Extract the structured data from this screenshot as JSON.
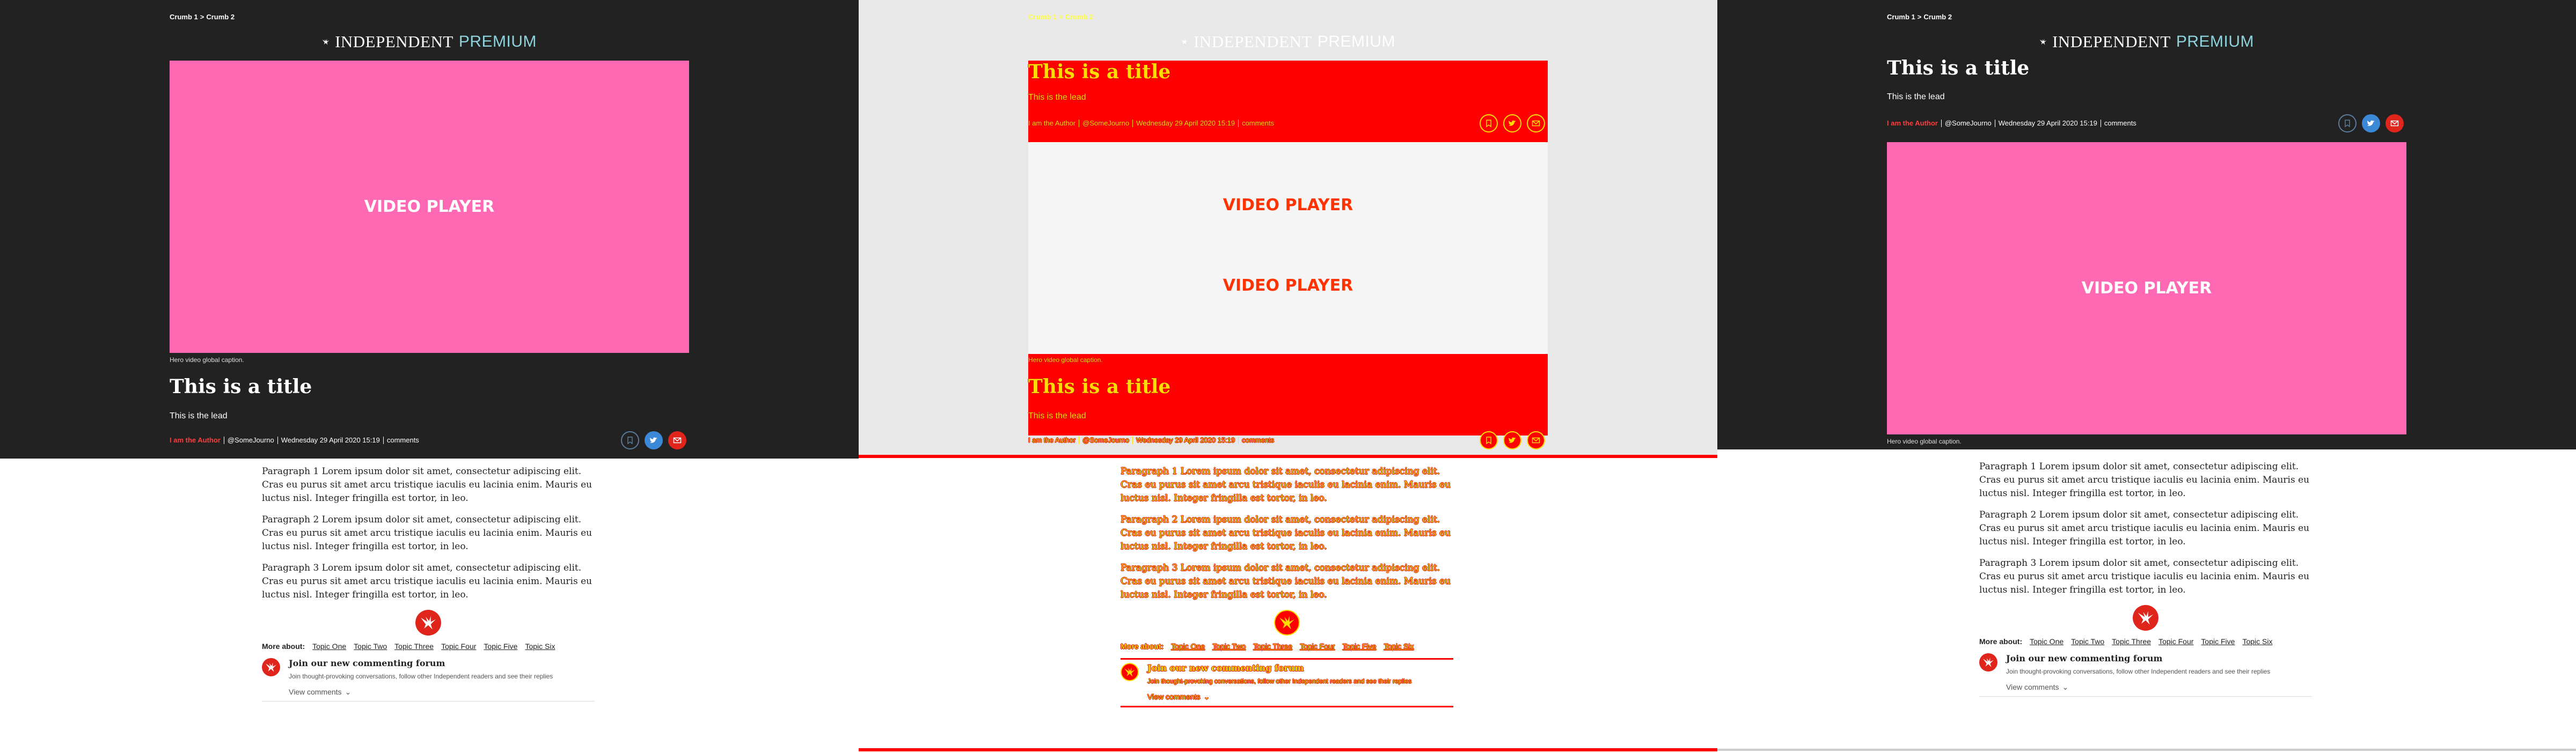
{
  "breadcrumbs": [
    "Crumb 1",
    "Crumb 2"
  ],
  "breadcrumb_separator": ">",
  "logo": {
    "brand": "INDEPENDENT",
    "premium": "PREMIUM"
  },
  "video": {
    "label": "VIDEO PLAYER",
    "caption": "Hero video global caption."
  },
  "article": {
    "title": "This is a title",
    "lead": "This is the lead",
    "author": "I am the Author",
    "handle": "@SomeJourno",
    "date": "Wednesday 29 April 2020 15:19",
    "comments_link": "comments"
  },
  "share": {
    "bookmark": "bookmark-icon",
    "twitter": "twitter-icon",
    "email": "email-icon"
  },
  "paragraphs": [
    "Paragraph 1 Lorem ipsum dolor sit amet, consectetur adipiscing elit. Cras eu purus sit amet arcu tristique iaculis eu lacinia enim. Mauris eu luctus nisl. Integer fringilla est tortor, in leo.",
    "Paragraph 2 Lorem ipsum dolor sit amet, consectetur adipiscing elit. Cras eu purus sit amet arcu tristique iaculis eu lacinia enim. Mauris eu luctus nisl. Integer fringilla est tortor, in leo.",
    "Paragraph 3 Lorem ipsum dolor sit amet, consectetur adipiscing elit. Cras eu purus sit amet arcu tristique iaculis eu lacinia enim. Mauris eu luctus nisl. Integer fringilla est tortor, in leo."
  ],
  "more_about": {
    "label": "More about:",
    "topics": [
      "Topic One",
      "Topic Two",
      "Topic Three",
      "Topic Four",
      "Topic Five",
      "Topic Six"
    ]
  },
  "comments_forum": {
    "title": "Join our new commenting forum",
    "subtitle": "Join thought-provoking conversations, follow other Independent readers and see their replies",
    "view_label": "View comments"
  },
  "colors": {
    "hero_bg": "#222222",
    "video_bg": "#ff69b4",
    "accent_red": "#e0251d",
    "premium_teal": "#8ed3dc",
    "twitter_blue": "#3b88d6"
  }
}
